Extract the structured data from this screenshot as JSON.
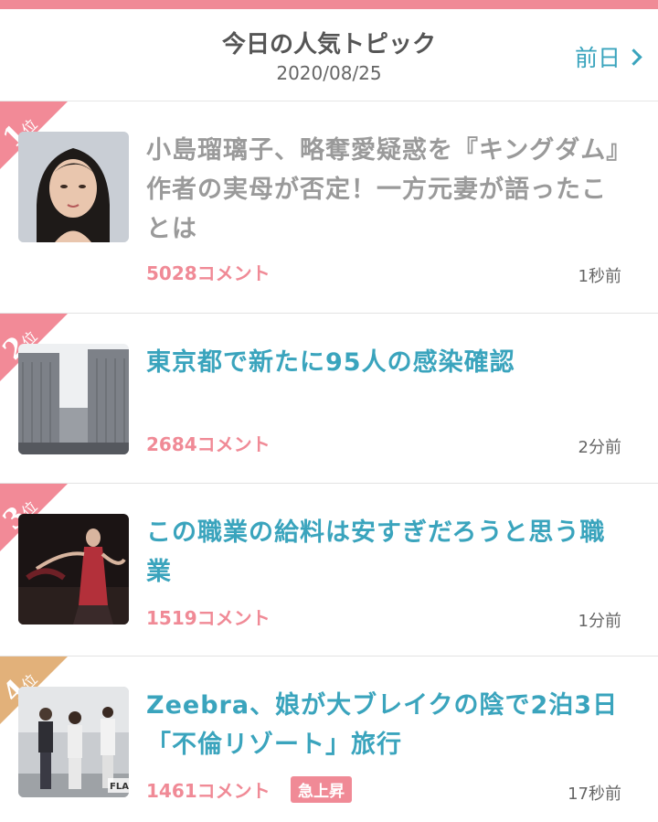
{
  "header": {
    "title": "今日の人気トピック",
    "date": "2020/08/25",
    "prev_label": "前日"
  },
  "topics": [
    {
      "rank": "1",
      "rank_suffix": "位",
      "headline": "小島瑠璃子、略奪愛疑惑を『キングダム』作者の実母が否定！一方元妻が語ったことは",
      "comments": "5028コメント",
      "time": "1秒前"
    },
    {
      "rank": "2",
      "rank_suffix": "位",
      "headline": "東京都で新たに95人の感染確認",
      "comments": "2684コメント",
      "time": "2分前"
    },
    {
      "rank": "3",
      "rank_suffix": "位",
      "headline": "この職業の給料は安すぎだろうと思う職業",
      "comments": "1519コメント",
      "time": "1分前"
    },
    {
      "rank": "4",
      "rank_suffix": "位",
      "headline": "Zeebra、娘が大ブレイクの陰で2泊3日「不倫リゾート」旅行",
      "comments": "1461コメント",
      "badge": "急上昇",
      "time": "17秒前",
      "thumb_text": "FLA"
    }
  ],
  "colors": {
    "accent_pink": "#f08a96",
    "link_teal": "#3aa4bd",
    "visited_gray": "#9a9a9a",
    "rank4_gold": "#e2b17a"
  }
}
